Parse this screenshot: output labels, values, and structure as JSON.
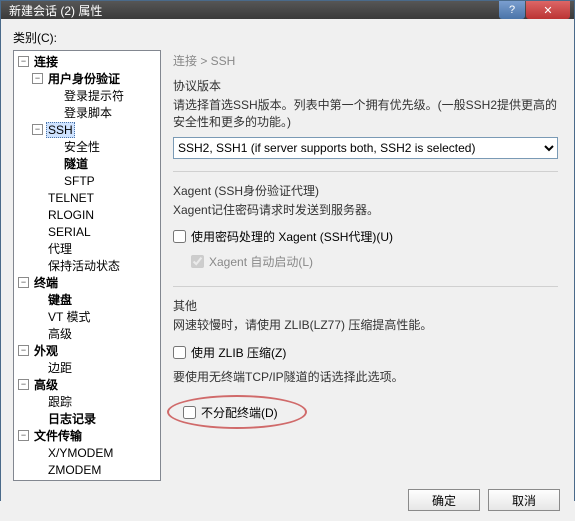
{
  "window": {
    "title": "新建会话 (2) 属性"
  },
  "category_label": "类别(C):",
  "tree": {
    "connection": "连接",
    "user_auth": "用户身份验证",
    "login_prompts": "登录提示符",
    "login_scripts": "登录脚本",
    "ssh": "SSH",
    "security": "安全性",
    "tunneling": "隧道",
    "sftp": "SFTP",
    "telnet": "TELNET",
    "rlogin": "RLOGIN",
    "serial": "SERIAL",
    "proxy": "代理",
    "keepalive": "保持活动状态",
    "terminal": "终端",
    "keyboard": "键盘",
    "vt": "VT 模式",
    "advanced_term": "高级",
    "appearance": "外观",
    "margins": "边距",
    "adv": "高级",
    "trace": "跟踪",
    "logging": "日志记录",
    "file_transfer": "文件传输",
    "xymodem": "X/YMODEM",
    "zmodem": "ZMODEM"
  },
  "right": {
    "crumb": "连接 > SSH",
    "proto_section": "协议版本",
    "proto_desc": "请选择首选SSH版本。列表中第一个拥有优先级。(一般SSH2提供更高的安全性和更多的功能。)",
    "proto_value": "SSH2, SSH1 (if server supports both, SSH2 is selected)",
    "xagent_section": "Xagent (SSH身份验证代理)",
    "xagent_desc": "Xagent记住密码请求时发送到服务器。",
    "cb_xagent": "使用密码处理的 Xagent (SSH代理)(U)",
    "cb_xagent_auto": "Xagent 自动启动(L)",
    "other_section": "其他",
    "other_desc": "网速较慢时，请使用 ZLIB(LZ77) 压缩提高性能。",
    "cb_zlib": "使用 ZLIB 压缩(Z)",
    "zlib_hint": "要使用无终端TCP/IP隧道的话选择此选项。",
    "cb_nopty": "不分配终端(D)"
  },
  "buttons": {
    "ok": "确定",
    "cancel": "取消"
  }
}
